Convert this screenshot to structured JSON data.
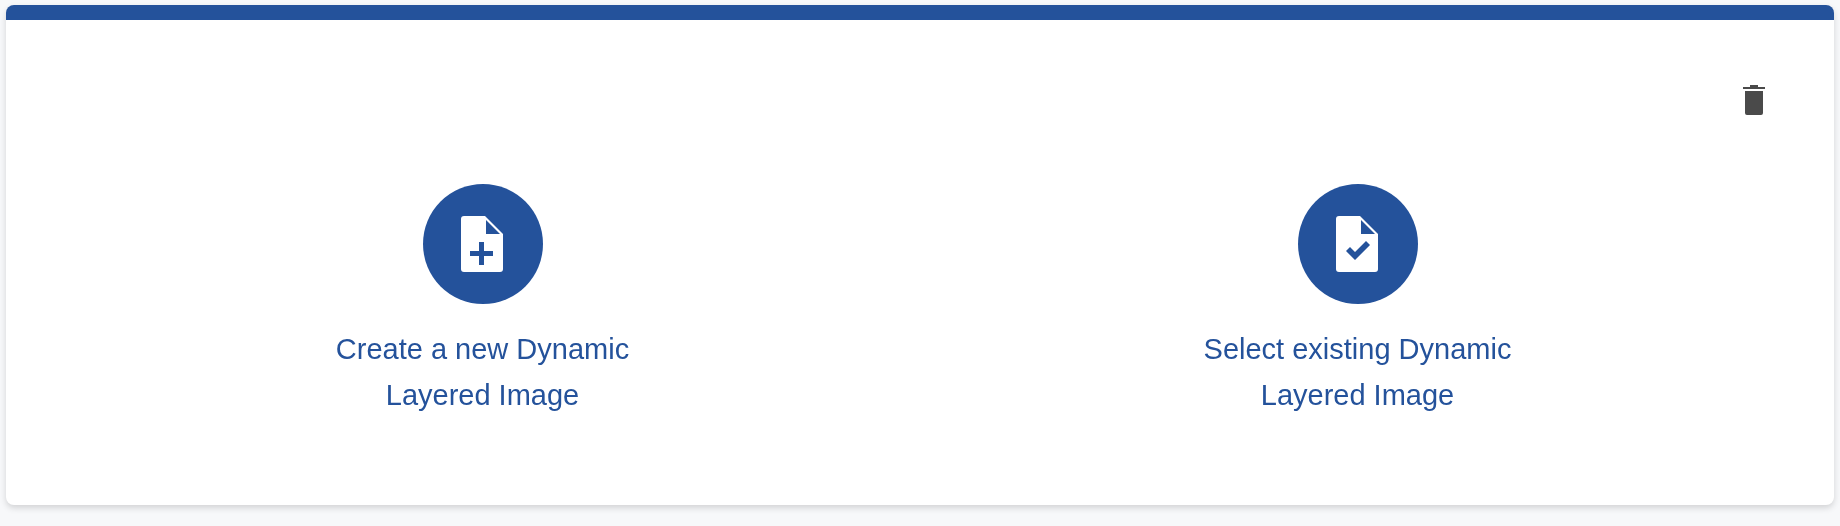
{
  "options": [
    {
      "kind": "create",
      "label": "Create a new Dynamic Layered Image"
    },
    {
      "kind": "select",
      "label": "Select existing Dynamic Layered Image"
    }
  ]
}
